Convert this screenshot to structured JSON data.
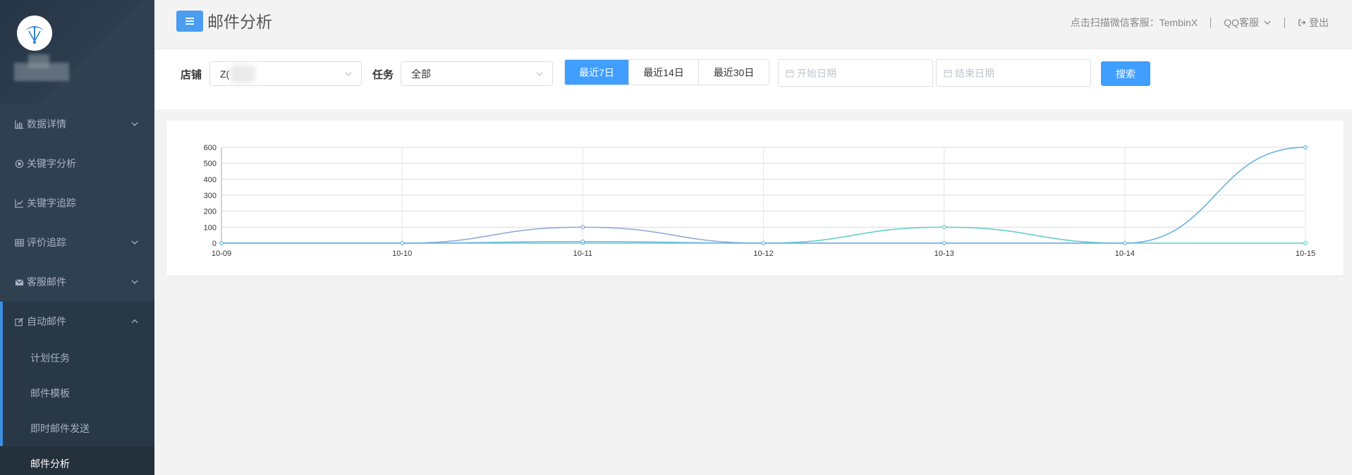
{
  "header": {
    "page_title": "邮件分析",
    "wechat_service": "点击扫描微信客服：TembinX",
    "qq_service": "QQ客服",
    "logout": "登出"
  },
  "sidebar": {
    "items": [
      {
        "label": "数据详情",
        "icon": "bar-chart-icon",
        "has_submenu": true
      },
      {
        "label": "关键字分析",
        "icon": "target-icon",
        "has_submenu": false
      },
      {
        "label": "关键字追踪",
        "icon": "line-chart-icon",
        "has_submenu": false
      },
      {
        "label": "评价追踪",
        "icon": "table-icon",
        "has_submenu": true
      },
      {
        "label": "客服邮件",
        "icon": "envelope-icon",
        "has_submenu": true
      },
      {
        "label": "自动邮件",
        "icon": "edit-icon",
        "has_submenu": true,
        "expanded": true
      }
    ],
    "subitems": [
      {
        "label": "计划任务"
      },
      {
        "label": "邮件模板"
      },
      {
        "label": "即时邮件发送"
      },
      {
        "label": "邮件分析",
        "current": true
      }
    ]
  },
  "filter": {
    "shop_label": "店铺",
    "shop_value": "Z(",
    "task_label": "任务",
    "task_value": "全部",
    "ranges": [
      "最近7日",
      "最近14日",
      "最近30日"
    ],
    "active_range": 0,
    "start_placeholder": "开始日期",
    "end_placeholder": "结束日期",
    "search_label": "搜索"
  },
  "colors": {
    "sidebar_bg": "#2f4050",
    "primary": "#409eff",
    "series_a": "#8fa4d6",
    "series_b": "#5ecbc6",
    "series_c": "#6ab6e0"
  },
  "chart_data": {
    "type": "line",
    "categories": [
      "10-09",
      "10-10",
      "10-11",
      "10-12",
      "10-13",
      "10-14",
      "10-15"
    ],
    "series": [
      {
        "values": [
          0,
          0,
          100,
          0,
          0,
          0,
          600
        ],
        "color": "#8fa4d6"
      },
      {
        "values": [
          0,
          0,
          0,
          0,
          100,
          0,
          0
        ],
        "color": "#5ecbc6"
      },
      {
        "values": [
          0,
          0,
          10,
          0,
          0,
          0,
          600
        ],
        "color": "#6ab6e0"
      }
    ],
    "y_ticks": [
      0,
      100,
      200,
      300,
      400,
      500,
      600
    ],
    "ylim": [
      0,
      600
    ],
    "grid": true
  }
}
